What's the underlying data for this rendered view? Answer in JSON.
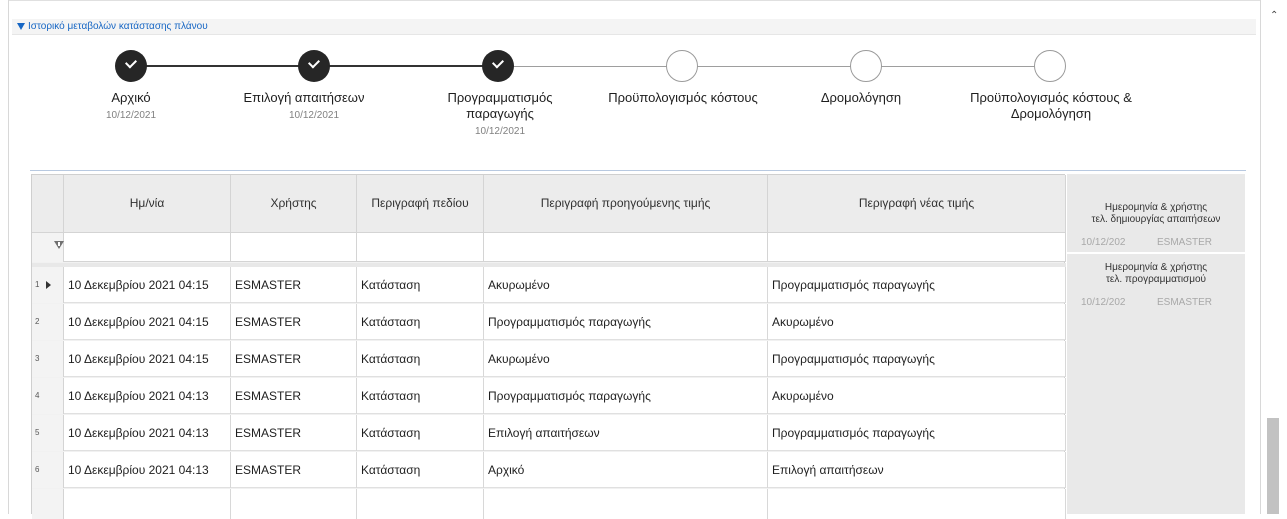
{
  "section": {
    "title": "Ιστορικό μεταβολών κατάστασης πλάνου"
  },
  "steps": [
    {
      "label": "Αρχικό",
      "date": "10/12/2021",
      "status": "done"
    },
    {
      "label": "Επιλογή απαιτήσεων",
      "date": "10/12/2021",
      "status": "done"
    },
    {
      "label_line1": "Προγραμματισμός",
      "label_line2": "παραγωγής",
      "date": "10/12/2021",
      "status": "done"
    },
    {
      "label": "Προϋπολογισμός κόστους",
      "date": "",
      "status": "pending"
    },
    {
      "label": "Δρομολόγηση",
      "date": "",
      "status": "pending"
    },
    {
      "label_line1": "Προϋπολογισμός κόστους &",
      "label_line2": "Δρομολόγηση",
      "date": "",
      "status": "pending"
    }
  ],
  "grid": {
    "columns": [
      "Ημ/νία",
      "Χρήστης",
      "Περιγραφή πεδίου",
      "Περιγραφή προηγούμενης τιμής",
      "Περιγραφή νέας τιμής"
    ],
    "rows": [
      {
        "num": "1",
        "date": "10 Δεκεμβρίου 2021 04:15",
        "user": "ESMASTER",
        "field": "Κατάσταση",
        "prev": "Ακυρωμένο",
        "next": "Προγραμματισμός παραγωγής"
      },
      {
        "num": "2",
        "date": "10 Δεκεμβρίου 2021 04:15",
        "user": "ESMASTER",
        "field": "Κατάσταση",
        "prev": "Προγραμματισμός παραγωγής",
        "next": "Ακυρωμένο"
      },
      {
        "num": "3",
        "date": "10 Δεκεμβρίου 2021 04:15",
        "user": "ESMASTER",
        "field": "Κατάσταση",
        "prev": "Ακυρωμένο",
        "next": "Προγραμματισμός παραγωγής"
      },
      {
        "num": "4",
        "date": "10 Δεκεμβρίου 2021 04:13",
        "user": "ESMASTER",
        "field": "Κατάσταση",
        "prev": "Προγραμματισμός παραγωγής",
        "next": "Ακυρωμένο"
      },
      {
        "num": "5",
        "date": "10 Δεκεμβρίου 2021 04:13",
        "user": "ESMASTER",
        "field": "Κατάσταση",
        "prev": "Επιλογή απαιτήσεων",
        "next": "Προγραμματισμός παραγωγής"
      },
      {
        "num": "6",
        "date": "10 Δεκεμβρίου 2021 04:13",
        "user": "ESMASTER",
        "field": "Κατάσταση",
        "prev": "Αρχικό",
        "next": "Επιλογή απαιτήσεων"
      }
    ]
  },
  "side_panel": {
    "block1": {
      "title_line1": "Ημερομηνία & χρήστης",
      "title_line2": "τελ. δημιουργίας απαιτήσεων",
      "date": "10/12/202",
      "user": "ESMASTER"
    },
    "block2": {
      "title_line1": "Ημερομηνία & χρήστης",
      "title_line2": "τελ. προγραμματισμού",
      "date": "10/12/202",
      "user": "ESMASTER"
    }
  },
  "icons": {
    "collapse": "triangle-down-icon",
    "filter": "filter-icon",
    "scroll_up": "chevron-up-icon",
    "check": "check-icon"
  },
  "colors": {
    "accent": "#1666c4",
    "done_node": "#262626",
    "pending_node_border": "#9a9a9a"
  }
}
